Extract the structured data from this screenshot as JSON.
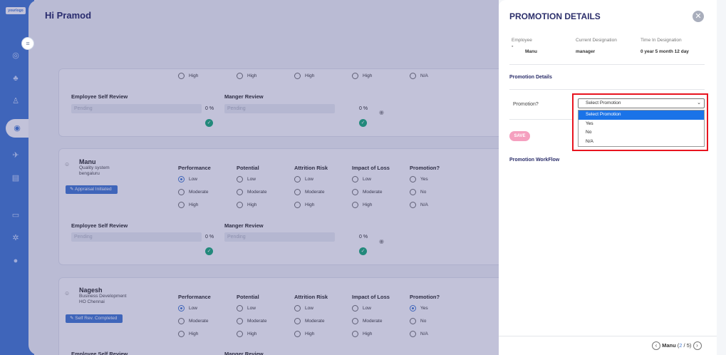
{
  "app": {
    "logo_text": "yourlogo",
    "greeting": "Hi Pramod"
  },
  "sidebar": {
    "icons": [
      "dashboard-icon",
      "team-icon",
      "org-icon",
      "appraisal-icon",
      "goals-icon",
      "reports-icon",
      "settings-icon",
      "profile-icon",
      "user-icon"
    ]
  },
  "columns": {
    "performance": "Performance",
    "potential": "Potential",
    "attrition": "Attrition Risk",
    "impact": "Impact of Loss",
    "promotion": "Promotion?"
  },
  "levels": {
    "low": "Low",
    "moderate": "Moderate",
    "high": "High"
  },
  "promo_opts": {
    "yes": "Yes",
    "no": "No",
    "na": "N/A"
  },
  "review": {
    "self": "Employee Self Review",
    "manager": "Manger Review",
    "pending": "Pending",
    "pct": "0 %"
  },
  "employees": [
    {
      "name": "Manu",
      "dept": "Quality system",
      "location": "bengaluru",
      "status": "Appraisal Initiated"
    },
    {
      "name": "Nagesh",
      "dept": "Business Development",
      "location": "HO Chennai",
      "status": "Self Rev. Completed"
    }
  ],
  "panel": {
    "title": "PROMOTION DETAILS",
    "employee_label": "Employee",
    "employee_name": "Manu",
    "designation_label": "Current Designation",
    "designation_value": "manager",
    "time_label": "Time In Designation",
    "time_value": "0 year 5 month 12 day",
    "promotion_details_heading": "Promotion Details",
    "promotion_field_label": "Promotion?",
    "select_value": "Select Promotion",
    "options": [
      "Select Promotion",
      "Yes",
      "No",
      "N/A"
    ],
    "save_label": "SAVE",
    "workflow_heading": "Promotion WorkFlow",
    "pager": {
      "name": "Manu",
      "current": "2",
      "sep": "/",
      "total": "5"
    }
  },
  "colors": {
    "accent": "#4a7fd4",
    "title": "#2c2f6b",
    "highlight": "#e8141f",
    "success": "#22b07d"
  }
}
